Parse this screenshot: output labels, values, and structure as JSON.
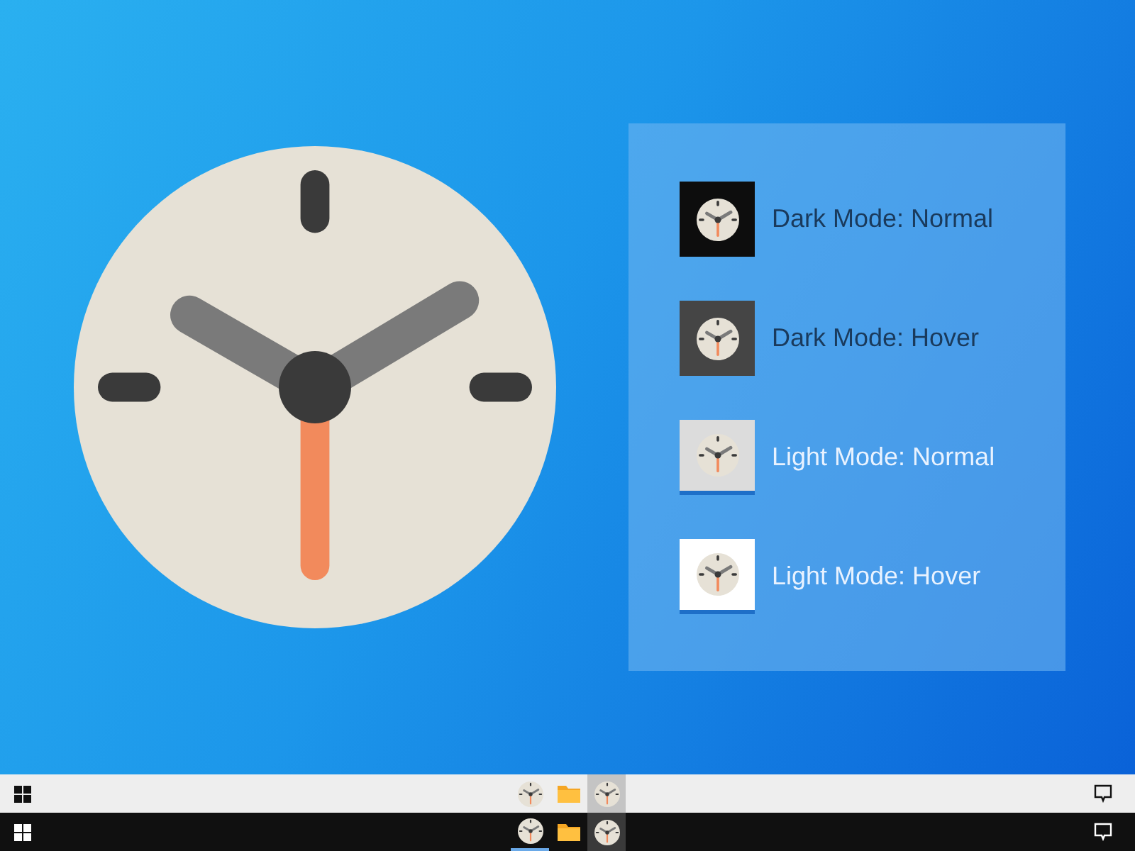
{
  "variants": [
    {
      "label": "Dark Mode: Normal",
      "kind": "dark",
      "hovered": false
    },
    {
      "label": "Dark Mode: Hover",
      "kind": "dark",
      "hovered": true
    },
    {
      "label": "Light Mode: Normal",
      "kind": "light",
      "hovered": false
    },
    {
      "label": "Light Mode: Hover",
      "kind": "light",
      "hovered": true
    }
  ],
  "taskbars": [
    {
      "kind": "light",
      "items": [
        {
          "kind": "clock",
          "hovered": false
        },
        {
          "kind": "folder",
          "hovered": false
        },
        {
          "kind": "clock",
          "hovered": true
        }
      ]
    },
    {
      "kind": "dark",
      "items": [
        {
          "kind": "clock",
          "hovered": false
        },
        {
          "kind": "folder",
          "hovered": false
        },
        {
          "kind": "clock",
          "hovered": true
        }
      ]
    }
  ]
}
